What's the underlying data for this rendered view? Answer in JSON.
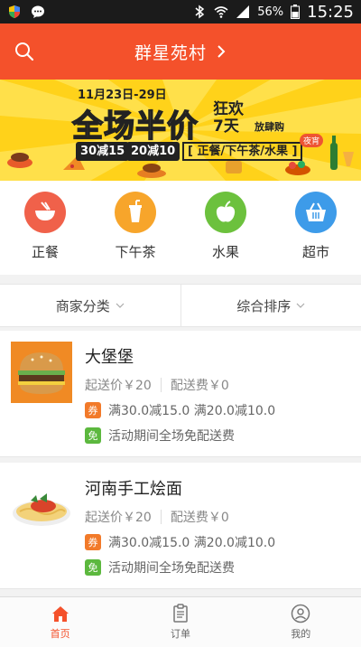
{
  "status_bar": {
    "battery": "56%",
    "time": "15:25",
    "icons": [
      "shield-icon",
      "message-icon",
      "bluetooth-icon",
      "wifi-icon",
      "signal-icon",
      "battery-icon"
    ]
  },
  "header": {
    "title": "群星苑村",
    "icons": [
      "search-icon",
      "chevron-right-icon"
    ],
    "color": "#f4512b"
  },
  "banner": {
    "date_range": "11月23日-29日",
    "headline": "全场半价",
    "sub_headline": "狂欢 7天",
    "sub_text": "放肆购",
    "deal_1": "30减15",
    "deal_2": "20减10",
    "categories": "[ 正餐/下午茶/水果 ]",
    "night_tag": "夜宵",
    "background": "#ffe04a"
  },
  "categories": [
    {
      "label": "正餐",
      "icon": "bowl-icon",
      "color": "#f0614a"
    },
    {
      "label": "下午茶",
      "icon": "drink-icon",
      "color": "#f7a52b"
    },
    {
      "label": "水果",
      "icon": "apple-icon",
      "color": "#6cc13d"
    },
    {
      "label": "超市",
      "icon": "basket-icon",
      "color": "#3d9be9"
    }
  ],
  "filters": [
    {
      "label": "商家分类",
      "icon": "chevron-down-icon"
    },
    {
      "label": "综合排序",
      "icon": "chevron-down-icon"
    }
  ],
  "shops": [
    {
      "name": "大堡堡",
      "min_order": "起送价￥20",
      "delivery_fee": "配送费￥0",
      "promo_badge_1": "券",
      "promo_1": "满30.0减15.0 满20.0减10.0",
      "promo_badge_2": "免",
      "promo_2": "活动期间全场免配送费",
      "thumb_icon": "burger-icon"
    },
    {
      "name": "河南手工烩面",
      "min_order": "起送价￥20",
      "delivery_fee": "配送费￥0",
      "promo_badge_1": "券",
      "promo_1": "满30.0减15.0 满20.0减10.0",
      "promo_badge_2": "免",
      "promo_2": "活动期间全场免配送费",
      "thumb_icon": "noodle-icon"
    }
  ],
  "tabbar": [
    {
      "label": "首页",
      "icon": "home-icon",
      "active": true
    },
    {
      "label": "订单",
      "icon": "order-icon",
      "active": false
    },
    {
      "label": "我的",
      "icon": "user-icon",
      "active": false
    }
  ]
}
